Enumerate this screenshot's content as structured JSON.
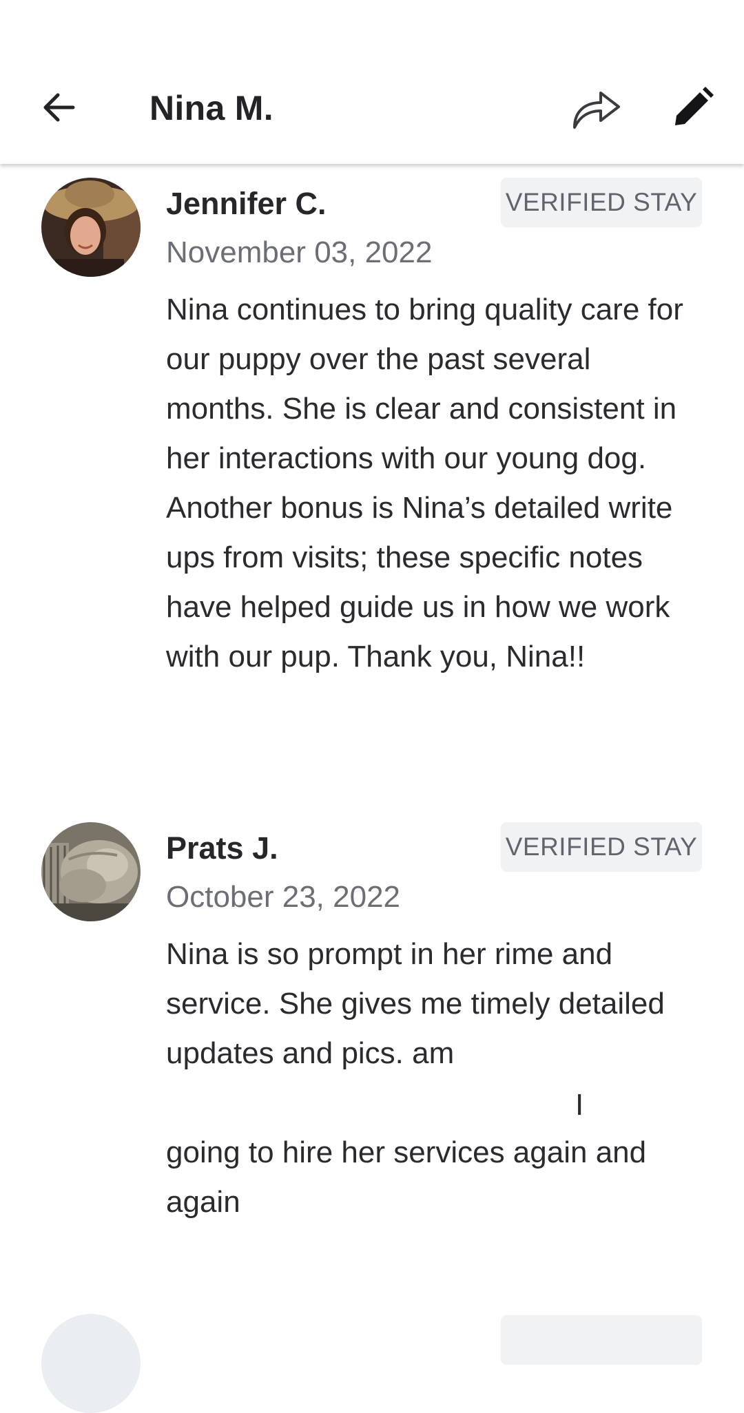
{
  "header": {
    "title": "Nina M.",
    "back_icon": "arrow-left-icon",
    "share_icon": "share-arrow-icon",
    "edit_icon": "pencil-icon"
  },
  "reviews": [
    {
      "name": "Jennifer C.",
      "badge": "VERIFIED STAY",
      "date": "November 03, 2022",
      "text": "Nina continues to bring quality care for our puppy over the past several months. She is clear and consistent in her interactions with our young dog. Another bonus is Nina’s detailed write ups from visits; these specific notes have helped guide us in how we work with our pup. Thank you, Nina!!"
    },
    {
      "name": "Prats J.",
      "badge": "VERIFIED STAY",
      "date": "October 23, 2022",
      "text_part1": "Nina is so prompt in her rime and service. She gives me timely detailed updates and pics.   am",
      "stray_char": "I",
      "text_part2": "going to hire her services again and again"
    }
  ],
  "colors": {
    "badge_bg": "#f1f2f4",
    "badge_text": "#62646b",
    "date_text": "#6b6e75",
    "body_text": "#2a2a2f"
  }
}
